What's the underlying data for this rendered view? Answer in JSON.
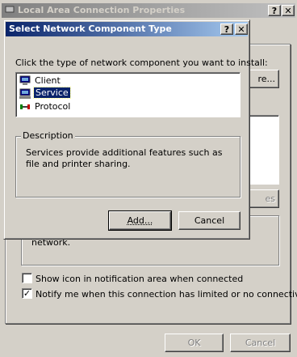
{
  "back_window": {
    "title": "Local Area Connection Properties",
    "help_btn": "?",
    "close_btn": "✕",
    "configure_btn_fragment": "re...",
    "properties_btn_fragment": "es",
    "desc_fragment": "network.",
    "show_icon_label": "Show icon in notification area when connected",
    "notify_label": "Notify me when this connection has limited or no connectivity",
    "notify_checked": "✓",
    "ok": "OK",
    "cancel": "Cancel"
  },
  "dialog": {
    "title": "Select Network Component Type",
    "help_btn": "?",
    "close_btn": "✕",
    "instruction": "Click the type of network component you want to install:",
    "components": [
      {
        "label": "Client",
        "icon": "client-icon"
      },
      {
        "label": "Service",
        "icon": "service-icon"
      },
      {
        "label": "Protocol",
        "icon": "protocol-icon"
      }
    ],
    "selected_index": 1,
    "description_title": "Description",
    "description_text": "Services provide additional features such as file and printer sharing.",
    "add_btn": "Add...",
    "cancel_btn": "Cancel"
  }
}
